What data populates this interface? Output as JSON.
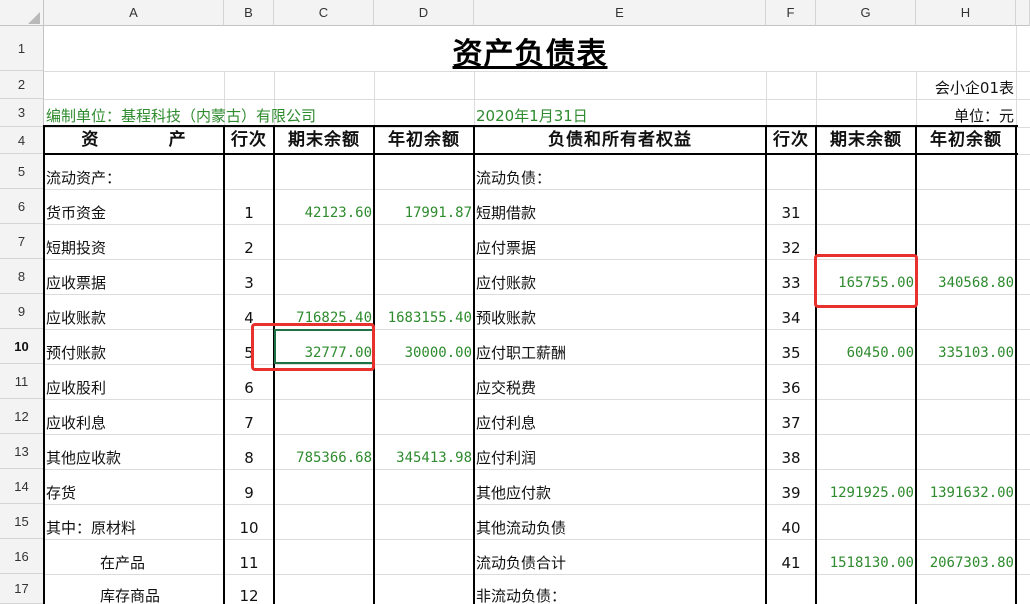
{
  "columns": [
    "A",
    "B",
    "C",
    "D",
    "E",
    "F",
    "G",
    "H"
  ],
  "rows": [
    "1",
    "2",
    "3",
    "4",
    "5",
    "6",
    "7",
    "8",
    "9",
    "10",
    "11",
    "12",
    "13",
    "14",
    "15",
    "16",
    "17"
  ],
  "title": "资产负债表",
  "form_code": "会小企01表",
  "company": "编制单位：基程科技（内蒙古）有限公司",
  "date": "2020年1月31日",
  "unit": "单位：元",
  "headers": {
    "asset": "资          产",
    "line": "行次",
    "end_balance": "期末余额",
    "begin_balance": "年初余额",
    "liability": "负债和所有者权益",
    "line2": "行次",
    "end_balance2": "期末余额",
    "begin_balance2": "年初余额"
  },
  "body_rows": [
    {
      "asset": "流动资产：",
      "line": "",
      "end": "",
      "begin": "",
      "liab": "流动负债：",
      "line2": "",
      "end2": "",
      "begin2": ""
    },
    {
      "asset": "货币资金",
      "line": "1",
      "end": "42123.60",
      "begin": "17991.87",
      "liab": "短期借款",
      "line2": "31",
      "end2": "",
      "begin2": ""
    },
    {
      "asset": "短期投资",
      "line": "2",
      "end": "",
      "begin": "",
      "liab": "应付票据",
      "line2": "32",
      "end2": "",
      "begin2": ""
    },
    {
      "asset": "应收票据",
      "line": "3",
      "end": "",
      "begin": "",
      "liab": "应付账款",
      "line2": "33",
      "end2": "165755.00",
      "begin2": "340568.80"
    },
    {
      "asset": "应收账款",
      "line": "4",
      "end": "716825.40",
      "begin": "1683155.40",
      "liab": "预收账款",
      "line2": "34",
      "end2": "",
      "begin2": ""
    },
    {
      "asset": "预付账款",
      "line": "5",
      "end": "32777.00",
      "begin": "30000.00",
      "liab": "应付职工薪酬",
      "line2": "35",
      "end2": "60450.00",
      "begin2": "335103.00"
    },
    {
      "asset": "应收股利",
      "line": "6",
      "end": "",
      "begin": "",
      "liab": "应交税费",
      "line2": "36",
      "end2": "",
      "begin2": ""
    },
    {
      "asset": "应收利息",
      "line": "7",
      "end": "",
      "begin": "",
      "liab": "应付利息",
      "line2": "37",
      "end2": "",
      "begin2": ""
    },
    {
      "asset": "其他应收款",
      "line": "8",
      "end": "785366.68",
      "begin": "345413.98",
      "liab": "应付利润",
      "line2": "38",
      "end2": "",
      "begin2": ""
    },
    {
      "asset": "存货",
      "line": "9",
      "end": "",
      "begin": "",
      "liab": "其他应付款",
      "line2": "39",
      "end2": "1291925.00",
      "begin2": "1391632.00"
    },
    {
      "asset": "其中：原材料",
      "line": "10",
      "end": "",
      "begin": "",
      "liab": "其他流动负债",
      "line2": "40",
      "end2": "",
      "begin2": ""
    },
    {
      "asset": "在产品",
      "line": "11",
      "end": "",
      "begin": "",
      "liab": "流动负债合计",
      "line2": "41",
      "end2": "1518130.00",
      "begin2": "2067303.80"
    },
    {
      "asset": "库存商品",
      "line": "12",
      "end": "",
      "begin": "",
      "liab": "非流动负债：",
      "line2": "",
      "end2": "",
      "begin2": ""
    }
  ],
  "colors": {
    "value_green": "#2e8b2e",
    "highlight_red": "#e8302c"
  }
}
